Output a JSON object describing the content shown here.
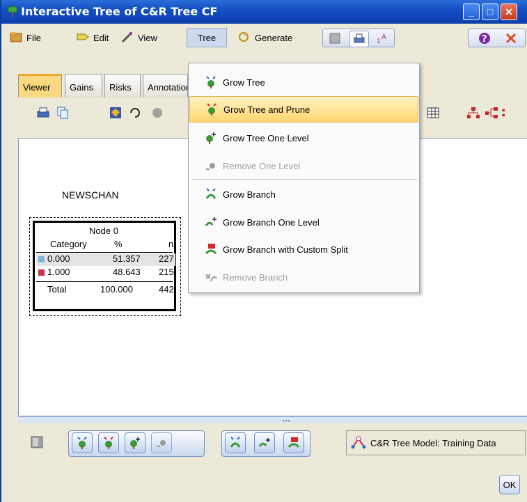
{
  "window": {
    "title": "Interactive Tree of C&R Tree CF"
  },
  "menubar": {
    "file": "File",
    "edit": "Edit",
    "view": "View",
    "tree": "Tree",
    "generate": "Generate"
  },
  "tabs": [
    "Viewer",
    "Gains",
    "Risks",
    "Annotations"
  ],
  "tree_menu": {
    "items": [
      {
        "label": "Grow Tree",
        "enabled": true,
        "icon": "grow-tree-icon"
      },
      {
        "label": "Grow Tree and Prune",
        "enabled": true,
        "highlighted": true,
        "icon": "grow-prune-icon"
      },
      {
        "label": "Grow Tree One Level",
        "enabled": true,
        "icon": "grow-level-icon"
      },
      {
        "label": "Remove One Level",
        "enabled": false,
        "icon": "remove-level-icon"
      },
      {
        "label": "Grow Branch",
        "enabled": true,
        "icon": "grow-branch-icon"
      },
      {
        "label": "Grow Branch One Level",
        "enabled": true,
        "icon": "grow-branch-level-icon"
      },
      {
        "label": "Grow Branch with Custom Split",
        "enabled": true,
        "icon": "custom-split-icon"
      },
      {
        "label": "Remove Branch",
        "enabled": false,
        "icon": "remove-branch-icon"
      }
    ]
  },
  "tree": {
    "field": "NEWSCHAN",
    "node": {
      "title": "Node 0",
      "headers": [
        "Category",
        "%",
        "n"
      ],
      "rows": [
        {
          "category": "0.000",
          "pct": "51.357",
          "n": "227",
          "color": "#7fb3d9"
        },
        {
          "category": "1.000",
          "pct": "48.643",
          "n": "215",
          "color": "#c8324a"
        }
      ],
      "total": {
        "label": "Total",
        "pct": "100.000",
        "n": "442"
      }
    }
  },
  "status": {
    "model_label": "C&R Tree Model: Training Data"
  },
  "buttons": {
    "ok": "OK"
  },
  "colors": {
    "titlebar": "#0e44b4",
    "highlight": "#ffd66e"
  }
}
